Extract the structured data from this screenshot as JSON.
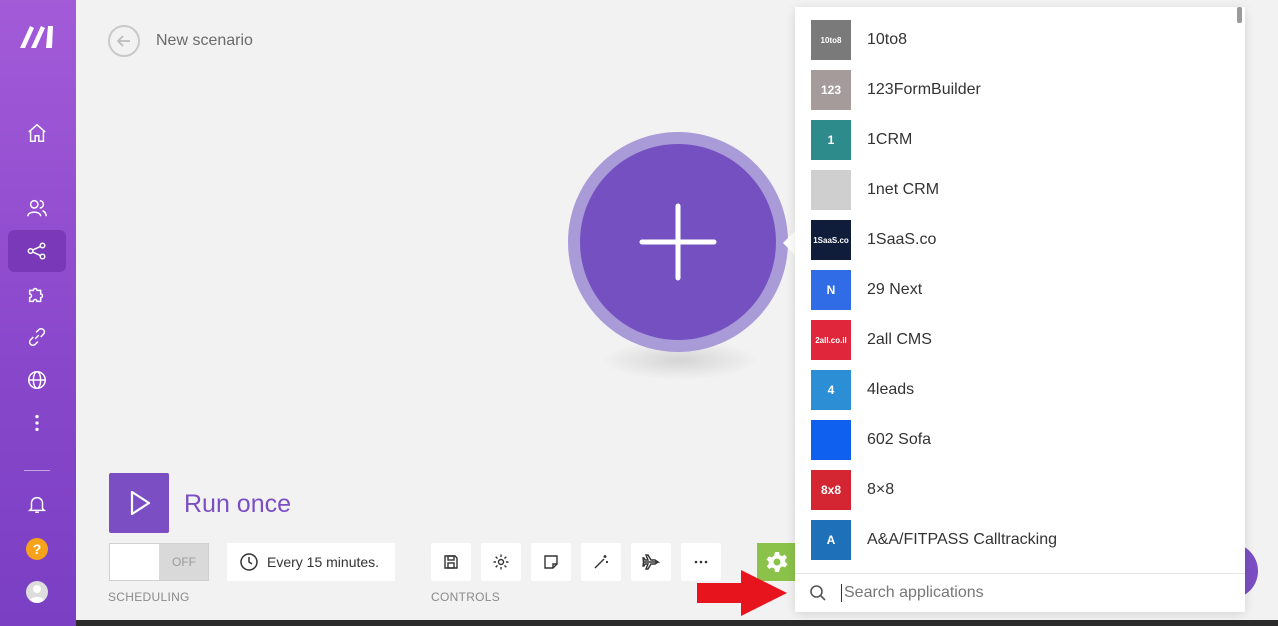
{
  "header": {
    "title": "New scenario"
  },
  "run": {
    "label": "Run once"
  },
  "scheduling": {
    "toggle_state": "OFF",
    "interval": "Every 15 minutes.",
    "label": "SCHEDULING"
  },
  "controls": {
    "label": "CONTROLS"
  },
  "colors": {
    "accent": "#7b4fc3",
    "sidebar_top": "#a35bd8",
    "sidebar_bottom": "#7a3fc3",
    "help": "#f7a21b"
  },
  "sidebar": {
    "items": [
      {
        "icon": "home-icon"
      },
      {
        "icon": "team-icon"
      },
      {
        "icon": "scenarios-icon",
        "active": true
      },
      {
        "icon": "apps-puzzle-icon"
      },
      {
        "icon": "connections-icon"
      },
      {
        "icon": "webhooks-globe-icon"
      },
      {
        "icon": "more-vertical-icon"
      }
    ],
    "help_label": "?"
  },
  "app_picker": {
    "apps": [
      {
        "name": "10to8",
        "icon_text": "10to8",
        "color": "#7a7a7a"
      },
      {
        "name": "123FormBuilder",
        "icon_text": "123",
        "color": "#a59b9b"
      },
      {
        "name": "1CRM",
        "icon_text": "1",
        "color": "#2e8b8b"
      },
      {
        "name": "1net CRM",
        "icon_text": "",
        "color": "#cfcfcf"
      },
      {
        "name": "1SaaS.co",
        "icon_text": "1SaaS.co",
        "color": "#0f1d3a"
      },
      {
        "name": "29 Next",
        "icon_text": "N",
        "color": "#2f6ce5"
      },
      {
        "name": "2all CMS",
        "icon_text": "2all.co.il",
        "color": "#e0263a"
      },
      {
        "name": "4leads",
        "icon_text": "4",
        "color": "#2c8fd6"
      },
      {
        "name": "602 Sofa",
        "icon_text": "",
        "color": "#1060f0"
      },
      {
        "name": "8×8",
        "icon_text": "8x8",
        "color": "#d42532"
      },
      {
        "name": "A&A/FITPASS Calltracking",
        "icon_text": "A",
        "color": "#1e70b8"
      }
    ],
    "search_placeholder": "Search applications"
  }
}
